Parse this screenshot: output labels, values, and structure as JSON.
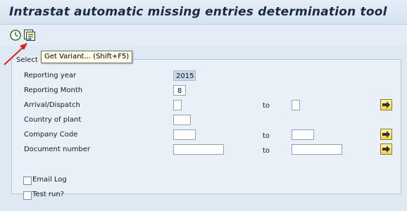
{
  "title": "Intrastat automatic missing entries determination tool",
  "toolbar": {
    "execute_icon": "execute-clock-icon",
    "variant_icon": "get-variant-icon",
    "tooltip": "Get Variant...  (Shift+F5)"
  },
  "selection": {
    "frame_label": "Selection",
    "visible_label": "Select",
    "fields": [
      {
        "label": "Reporting year",
        "value": "2015"
      },
      {
        "label": "Reporting Month",
        "value": "8"
      },
      {
        "label": "Arrival/Dispatch",
        "value": "",
        "to_label": "to",
        "to_value": ""
      },
      {
        "label": "Country of plant",
        "value": ""
      },
      {
        "label": "Company Code",
        "value": "",
        "to_label": "to",
        "to_value": ""
      },
      {
        "label": "Document number",
        "value": "",
        "to_label": "to",
        "to_value": ""
      }
    ],
    "options": [
      {
        "label": "Email Log",
        "checked": false
      },
      {
        "label": "Test run?",
        "checked": false
      }
    ]
  },
  "colors": {
    "title": "#1a2b48",
    "annotation_arrow": "#e11d1d",
    "multi_select": "#f2d24a"
  }
}
